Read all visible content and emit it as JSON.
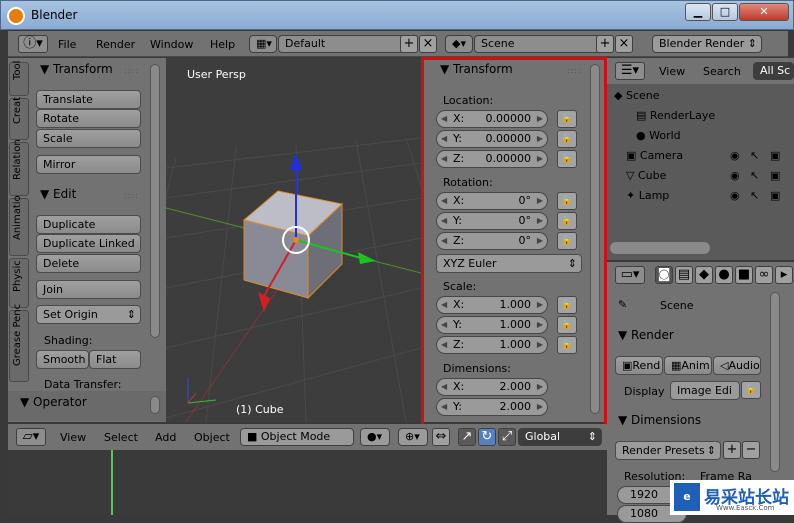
{
  "window": {
    "title": "Blender",
    "min": "▁",
    "max": "□",
    "close": "✕"
  },
  "menu": {
    "items": [
      "File",
      "Render",
      "Window",
      "Help"
    ],
    "layout": "Default",
    "scene": "Scene",
    "engine": "Blender Render",
    "info_icon": "info-icon"
  },
  "tool": {
    "tabs": [
      "Tool",
      "Creat",
      "Relation",
      "Animatio",
      "Physic",
      "Grease Penc"
    ],
    "transform_header": "Transform",
    "translate": "Translate",
    "rotate": "Rotate",
    "scale": "Scale",
    "mirror": "Mirror",
    "edit_header": "Edit",
    "duplicate": "Duplicate",
    "duplicate_linked": "Duplicate Linked",
    "delete": "Delete",
    "join": "Join",
    "set_origin": "Set Origin",
    "shading_label": "Shading:",
    "smooth": "Smooth",
    "flat": "Flat",
    "data_transfer": "Data Transfer:",
    "operator_header": "Operator"
  },
  "viewport": {
    "label": "User Persp",
    "object": "(1) Cube"
  },
  "props": {
    "header": "Transform",
    "location_label": "Location:",
    "location": [
      {
        "k": "X:",
        "v": "0.00000"
      },
      {
        "k": "Y:",
        "v": "0.00000"
      },
      {
        "k": "Z:",
        "v": "0.00000"
      }
    ],
    "rotation_label": "Rotation:",
    "rotation": [
      {
        "k": "X:",
        "v": "0°"
      },
      {
        "k": "Y:",
        "v": "0°"
      },
      {
        "k": "Z:",
        "v": "0°"
      }
    ],
    "rotation_mode": "XYZ Euler",
    "scale_label": "Scale:",
    "scale": [
      {
        "k": "X:",
        "v": "1.000"
      },
      {
        "k": "Y:",
        "v": "1.000"
      },
      {
        "k": "Z:",
        "v": "1.000"
      }
    ],
    "dimensions_label": "Dimensions:",
    "dimensions": [
      {
        "k": "X:",
        "v": "2.000"
      },
      {
        "k": "Y:",
        "v": "2.000"
      }
    ]
  },
  "outliner": {
    "view": "View",
    "search": "Search",
    "all": "All Sc",
    "items": [
      "Scene",
      "RenderLaye",
      "World",
      "Camera",
      "Cube",
      "Lamp"
    ]
  },
  "properties": {
    "scene": "Scene",
    "render_header": "Render",
    "render": "Rend",
    "anim": "Anim",
    "audio": "Audio",
    "display_label": "Display",
    "display_value": "Image Edi",
    "dimensions_header": "Dimensions",
    "presets": "Render Presets",
    "resolution": "Resolution:",
    "frame_rate": "Frame Ra",
    "res_x": "1920",
    "res_y": "1080"
  },
  "view3d_header": {
    "view": "View",
    "select": "Select",
    "add": "Add",
    "object": "Object",
    "mode": "Object Mode",
    "orientation": "Global"
  },
  "watermark": {
    "text": "易采站长站",
    "sub": "Www.Easck.Com"
  },
  "highlight_color": "#d01010"
}
